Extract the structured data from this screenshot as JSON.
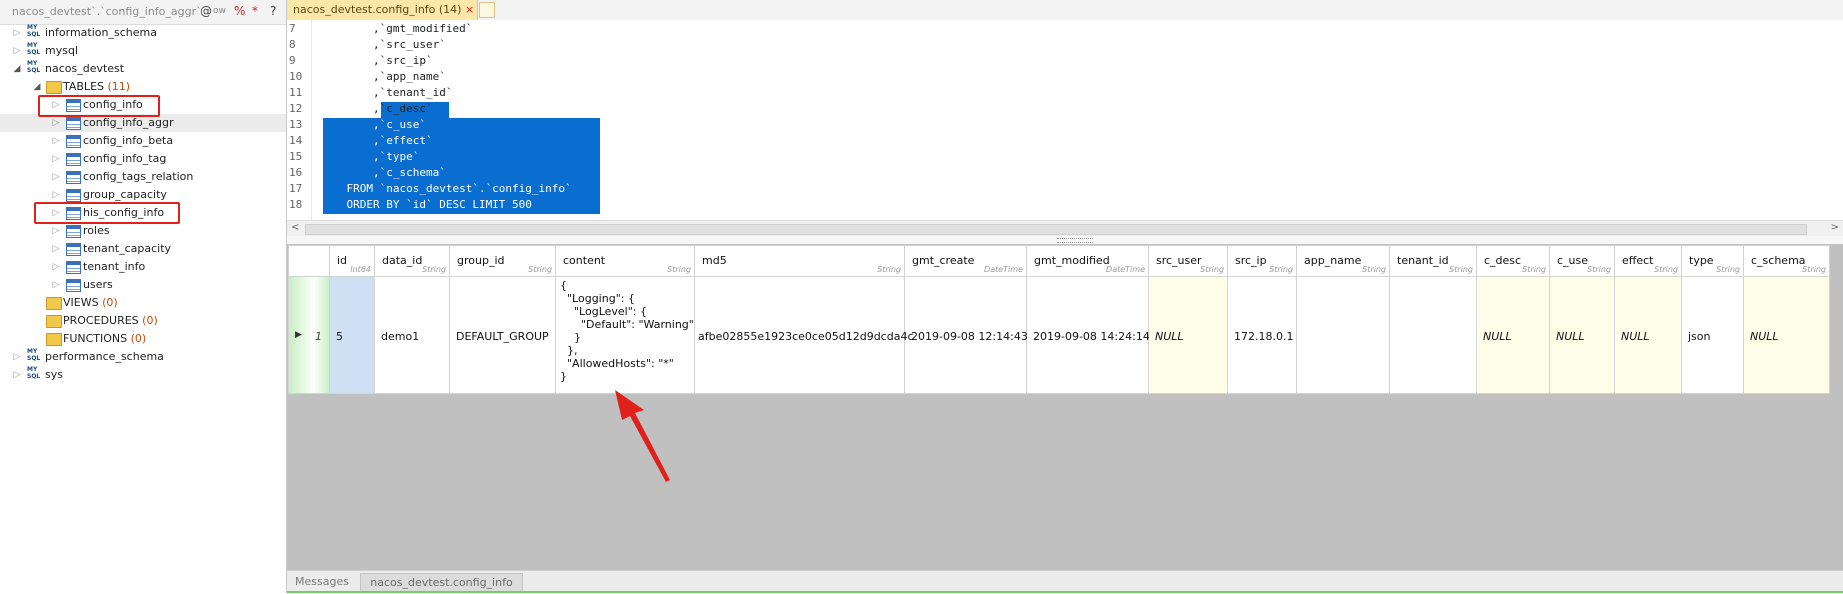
{
  "left_panel": {
    "header_title": "nacos_devtest`.`config_info_aggr`",
    "header_controls": [
      "@",
      "ow",
      "%",
      "*",
      "?"
    ],
    "tree": [
      {
        "label": "information_schema",
        "type": "db"
      },
      {
        "label": "mysql",
        "type": "db"
      },
      {
        "label": "nacos_devtest",
        "type": "db"
      },
      {
        "label": "TABLES",
        "count": "(11)",
        "type": "folder"
      },
      {
        "label": "config_info",
        "type": "table"
      },
      {
        "label": "config_info_aggr",
        "type": "table"
      },
      {
        "label": "config_info_beta",
        "type": "table"
      },
      {
        "label": "config_info_tag",
        "type": "table"
      },
      {
        "label": "config_tags_relation",
        "type": "table"
      },
      {
        "label": "group_capacity",
        "type": "table"
      },
      {
        "label": "his_config_info",
        "type": "table"
      },
      {
        "label": "roles",
        "type": "table"
      },
      {
        "label": "tenant_capacity",
        "type": "table"
      },
      {
        "label": "tenant_info",
        "type": "table"
      },
      {
        "label": "users",
        "type": "table"
      },
      {
        "label": "VIEWS",
        "count": "(0)",
        "type": "folder"
      },
      {
        "label": "PROCEDURES",
        "count": "(0)",
        "type": "folder"
      },
      {
        "label": "FUNCTIONS",
        "count": "(0)",
        "type": "folder"
      },
      {
        "label": "performance_schema",
        "type": "db"
      },
      {
        "label": "sys",
        "type": "db"
      }
    ]
  },
  "tabs": {
    "active_label": "nacos_devtest.config_info (14)",
    "close_glyph": "×"
  },
  "editor": {
    "lines": [
      {
        "no": "7",
        "text": "        ,`gmt_modified`"
      },
      {
        "no": "8",
        "text": "        ,`src_user`"
      },
      {
        "no": "9",
        "text": "        ,`src_ip`"
      },
      {
        "no": "10",
        "text": "        ,`app_name`"
      },
      {
        "no": "11",
        "text": "        ,`tenant_id`"
      },
      {
        "no": "12",
        "text": "        ,`c_desc`"
      },
      {
        "no": "13",
        "text": "        ,`c_use`"
      },
      {
        "no": "14",
        "text": "        ,`effect`"
      },
      {
        "no": "15",
        "text": "        ,`type`"
      },
      {
        "no": "16",
        "text": "        ,`c_schema`"
      },
      {
        "no": "17",
        "text": "    FROM `nacos_devtest`.`config_info`"
      },
      {
        "no": "18",
        "text": "    ORDER BY `id` DESC LIMIT 500"
      }
    ]
  },
  "grid": {
    "columns": [
      {
        "name": "id",
        "type": "Int64"
      },
      {
        "name": "data_id",
        "type": "String"
      },
      {
        "name": "group_id",
        "type": "String"
      },
      {
        "name": "content",
        "type": "String"
      },
      {
        "name": "md5",
        "type": "String"
      },
      {
        "name": "gmt_create",
        "type": "DateTime"
      },
      {
        "name": "gmt_modified",
        "type": "DateTime"
      },
      {
        "name": "src_user",
        "type": "String"
      },
      {
        "name": "src_ip",
        "type": "String"
      },
      {
        "name": "app_name",
        "type": "String"
      },
      {
        "name": "tenant_id",
        "type": "String"
      },
      {
        "name": "c_desc",
        "type": "String"
      },
      {
        "name": "c_use",
        "type": "String"
      },
      {
        "name": "effect",
        "type": "String"
      },
      {
        "name": "type",
        "type": "String"
      },
      {
        "name": "c_schema",
        "type": "String"
      }
    ],
    "row": {
      "row_number": "1",
      "id": "5",
      "data_id": "demo1",
      "group_id": "DEFAULT_GROUP",
      "content": "{\n  \"Logging\": {\n    \"LogLevel\": {\n      \"Default\": \"Warning\"\n    }\n  },\n  \"AllowedHosts\": \"*\"\n}",
      "md5": "afbe02855e1923ce0ce05d12d9dcda4c",
      "gmt_create": "2019-09-08 12:14:43",
      "gmt_modified": "2019-09-08 14:24:14",
      "src_user": "NULL",
      "src_ip": "172.18.0.1",
      "app_name": "",
      "tenant_id": "",
      "c_desc": "NULL",
      "c_use": "NULL",
      "effect": "NULL",
      "type": "json",
      "c_schema": "NULL"
    }
  },
  "bottom_tabs": [
    "Messages",
    "nacos_devtest.config_info"
  ],
  "colors": {
    "selection": "#0a6dd0",
    "annotation_red": "#e0201a",
    "tab_active": "#fbe7a8"
  }
}
